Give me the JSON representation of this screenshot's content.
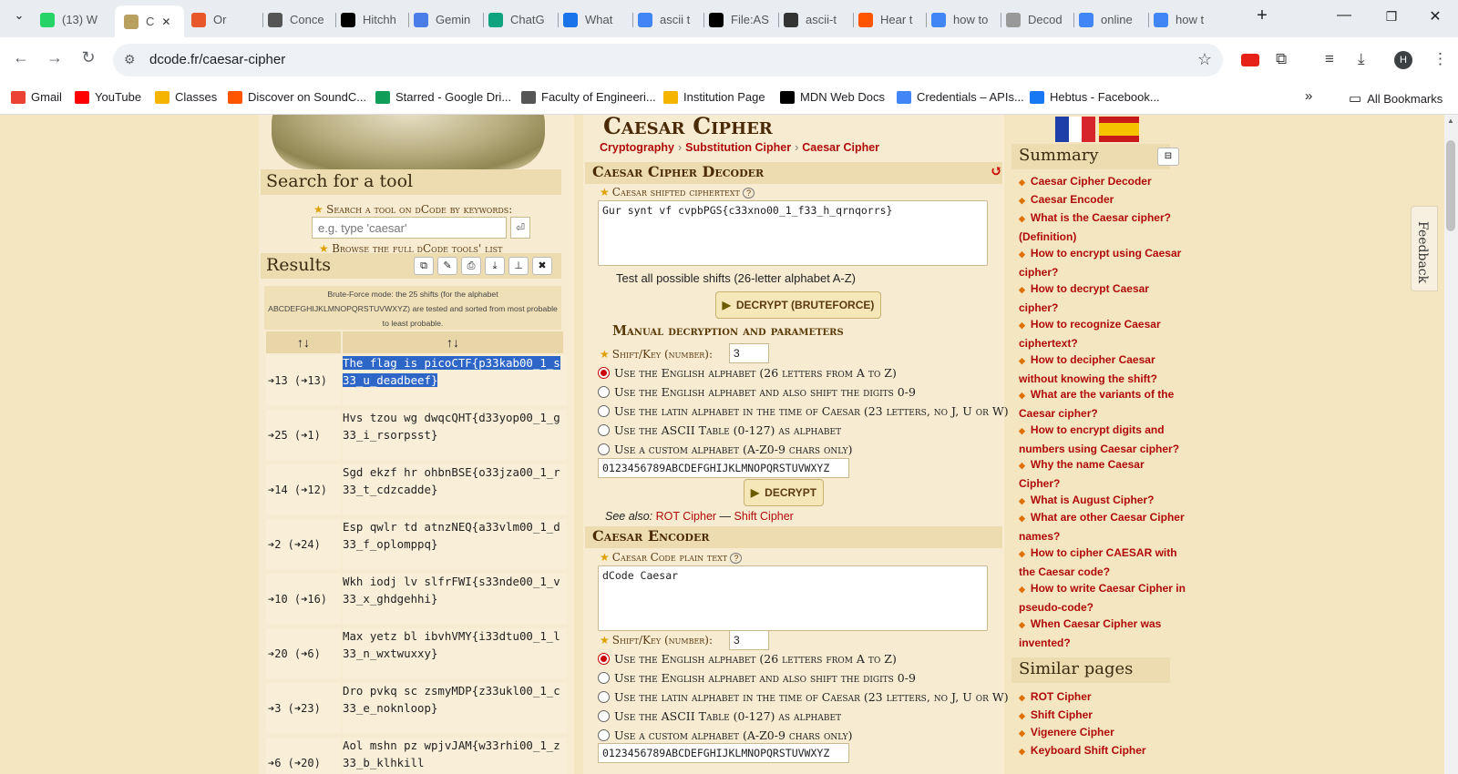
{
  "browser": {
    "tabs": [
      {
        "label": "(13) W",
        "icon": "whatsapp-icon",
        "color": "#25d366"
      },
      {
        "label": "C",
        "icon": "dcode-icon",
        "color": "#b8a060",
        "active": true
      },
      {
        "label": "Or",
        "icon": "search-icon",
        "color": "#e8572a"
      },
      {
        "label": "Conce",
        "icon": "table-icon",
        "color": "#555555"
      },
      {
        "label": "Hitchh",
        "icon": "medium-icon",
        "color": "#000000"
      },
      {
        "label": "Gemin",
        "icon": "gemini-icon",
        "color": "#4a7de8"
      },
      {
        "label": "ChatG",
        "icon": "chatgpt-icon",
        "color": "#10a37f"
      },
      {
        "label": "What",
        "icon": "doc-icon",
        "color": "#1a73e8"
      },
      {
        "label": "ascii t",
        "icon": "google-icon",
        "color": "#4285f4"
      },
      {
        "label": "File:AS",
        "icon": "wikipedia-icon",
        "color": "#000000"
      },
      {
        "label": "ascii-t",
        "icon": "globe-icon",
        "color": "#333333"
      },
      {
        "label": "Hear t",
        "icon": "soundcloud-icon",
        "color": "#ff5500"
      },
      {
        "label": "how to",
        "icon": "google-icon",
        "color": "#4285f4"
      },
      {
        "label": "Decod",
        "icon": "decoder-icon",
        "color": "#999999"
      },
      {
        "label": "online",
        "icon": "google-icon",
        "color": "#4285f4"
      },
      {
        "label": "how t",
        "icon": "google-icon",
        "color": "#4285f4"
      }
    ],
    "url": "dcode.fr/caesar-cipher",
    "bookmarks": [
      {
        "label": "Gmail",
        "icon": "gmail-icon",
        "color": "#ea4335"
      },
      {
        "label": "YouTube",
        "icon": "youtube-icon",
        "color": "#ff0000"
      },
      {
        "label": "Classes",
        "icon": "classroom-icon",
        "color": "#f4b400"
      },
      {
        "label": "Discover on SoundC...",
        "icon": "soundcloud-icon",
        "color": "#ff5500"
      },
      {
        "label": "Starred - Google Dri...",
        "icon": "drive-icon",
        "color": "#0f9d58"
      },
      {
        "label": "Faculty of Engineeri...",
        "icon": "globe-icon",
        "color": "#555555"
      },
      {
        "label": "Institution Page",
        "icon": "pencil-icon",
        "color": "#f4b400"
      },
      {
        "label": "MDN Web Docs",
        "icon": "mdn-icon",
        "color": "#000000"
      },
      {
        "label": "Credentials – APIs...",
        "icon": "api-icon",
        "color": "#4285f4"
      },
      {
        "label": "Hebtus - Facebook...",
        "icon": "facebook-icon",
        "color": "#1877f2"
      }
    ],
    "all_bookmarks": "All Bookmarks",
    "profile_initial": "H"
  },
  "left": {
    "search_title": "Search for a tool",
    "search_label": "Search a tool on dCode by keywords:",
    "search_placeholder": "e.g. type 'caesar'",
    "browse_prefix": "Browse the ",
    "browse_link": "full dCode tools' list",
    "results_title": "Results",
    "bruteforce_note": "Brute-Force mode: the 25 shifts (for the alphabet ABCDEFGHIJKLMNOPQRSTUVWXYZ) are tested and sorted from most probable to least probable.",
    "col1_header": "↑↓",
    "col2_header": "↑↓",
    "rows": [
      {
        "shift": "➔13 (➜13)",
        "text": "The flag is picoCTF{p33kab00_1_s33_u_deadbeef}",
        "selected": true
      },
      {
        "shift": "➔25 (➜1)",
        "text": "Hvs tzou wg dwqcQHT{d33yop00_1_g33_i_rsorpsst}"
      },
      {
        "shift": "➔14 (➜12)",
        "text": "Sgd ekzf hr ohbnBSE{o33jza00_1_r33_t_cdzcadde}"
      },
      {
        "shift": "➔2 (➜24)",
        "text": "Esp qwlr td atnzNEQ{a33vlm00_1_d33_f_oplomppq}"
      },
      {
        "shift": "➔10 (➜16)",
        "text": "Wkh iodj lv slfrFWI{s33nde00_1_v33_x_ghdgehhi}"
      },
      {
        "shift": "➔20 (➜6)",
        "text": "Max yetz bl ibvhVMY{i33dtu00_1_l33_n_wxtwuxxy}"
      },
      {
        "shift": "➔3 (➜23)",
        "text": "Dro pvkq sc zsmyMDP{z33ukl00_1_c33_e_noknloop}"
      },
      {
        "shift": "➔6 (➜20)",
        "text": "Aol mshn pz wpjvJAM{w33rhi00_1_z33_b_klhkill"
      }
    ]
  },
  "main": {
    "title": "Caesar Cipher",
    "breadcrumb": [
      "Cryptography",
      "Substitution Cipher",
      "Caesar Cipher"
    ],
    "decoder_title": "Caesar Cipher Decoder",
    "ciphertext_label": "Caesar shifted ciphertext",
    "ciphertext_value": "Gur synt vf cvpbPGS{c33xno00_1_f33_h_qrnqorrs}",
    "test_all_label": "Test all possible shifts (26-letter alphabet A-Z)",
    "bruteforce_button": "DECRYPT (BRUTEFORCE)",
    "manual_title": "Manual decryption and parameters",
    "shift_label": "Shift/Key (number):",
    "shift_value": "3",
    "alphabet_options": [
      "Use the English alphabet (26 letters from A to Z)",
      "Use the English alphabet and also shift the digits 0-9",
      "Use the latin alphabet in the time of Caesar (23 letters, no J, U or W)",
      "Use the ASCII Table (0-127) as alphabet",
      "Use a custom alphabet (A-Z0-9 chars only)"
    ],
    "custom_alphabet": "0123456789ABCDEFGHIJKLMNOPQRSTUVWXYZ",
    "decrypt_button": "DECRYPT",
    "see_also_label": "See also:",
    "see_also_links": [
      "ROT Cipher",
      "Shift Cipher"
    ],
    "encoder_title": "Caesar Encoder",
    "plaintext_label": "Caesar Code plain text",
    "plaintext_value": "dCode Caesar",
    "enc_shift_value": "3"
  },
  "summary": {
    "title": "Summary",
    "links": [
      "Caesar Cipher Decoder",
      "Caesar Encoder",
      "What is the Caesar cipher? (Definition)",
      "How to encrypt using Caesar cipher?",
      "How to decrypt Caesar cipher?",
      "How to recognize Caesar ciphertext?",
      "How to decipher Caesar without knowing the shift?",
      "What are the variants of the Caesar cipher?",
      "How to encrypt digits and numbers using Caesar cipher?",
      "Why the name Caesar Cipher?",
      "What is August Cipher?",
      "What are other Caesar Cipher names?",
      "How to cipher CAESAR with the Caesar code?",
      "How to write Caesar Cipher in pseudo-code?",
      "When Caesar Cipher was invented?"
    ],
    "similar_title": "Similar pages",
    "similar_links": [
      "ROT Cipher",
      "Shift Cipher",
      "Vigenere Cipher",
      "Keyboard Shift Cipher"
    ]
  },
  "feedback_label": "Feedback"
}
